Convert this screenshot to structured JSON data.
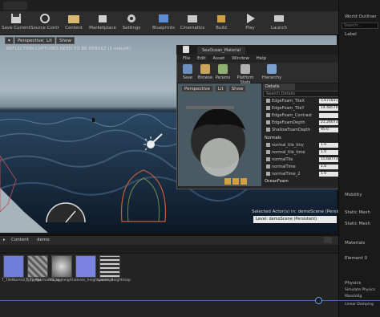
{
  "toolbar": {
    "buttons": [
      {
        "label": "Save Current",
        "icon": "save-icon"
      },
      {
        "label": "Source Control",
        "icon": "source-control-icon"
      },
      {
        "label": "Content",
        "icon": "content-icon"
      },
      {
        "label": "Marketplace",
        "icon": "marketplace-icon"
      },
      {
        "label": "Settings",
        "icon": "settings-icon"
      },
      {
        "label": "Blueprints",
        "icon": "blueprints-icon"
      },
      {
        "label": "Cinematics",
        "icon": "cinematics-icon"
      },
      {
        "label": "Build",
        "icon": "build-icon"
      },
      {
        "label": "Play",
        "icon": "play-icon"
      },
      {
        "label": "Launch",
        "icon": "launch-icon"
      }
    ]
  },
  "sidebar": {
    "world_outliner": "World Outliner",
    "search": "Search...",
    "label": "Label",
    "mobility": "Mobility",
    "static_mesh_section": "Static Mesh",
    "static_mesh": "Static Mesh",
    "materials": "Materials",
    "element0": "Element 0",
    "physics": "Physics",
    "simulate": "Simulate Physics",
    "mass": "MassInKg",
    "linear_damping": "Linear Damping"
  },
  "viewport": {
    "perspective": "Perspective",
    "lit": "Lit",
    "show": "Show",
    "warning": "REFLECTION CAPTURES NEED TO BE REBUILT (1 unbuilt)",
    "selected_actors": "Selected Actor(s) in: demoScene (Persistent)",
    "level": "Level: demoScene (Persistent)"
  },
  "material_window": {
    "tab": "SeaOcean_Material",
    "menus": [
      "File",
      "Edit",
      "Asset",
      "Window",
      "Help"
    ],
    "tools": [
      "Save",
      "Browse",
      "Params",
      "Platform Stats",
      "Hierarchy"
    ],
    "preview": {
      "perspective": "Perspective",
      "lit": "Lit",
      "show": "Show"
    },
    "details_tab": "Details",
    "search": "Search Details",
    "params": [
      {
        "name": "EdgeFoam_TileX",
        "value": "5.671831"
      },
      {
        "name": "EdgeFoam_TileY",
        "value": "14.485769"
      },
      {
        "name": "EdgeFoam_Contrast",
        "value": ""
      },
      {
        "name": "EdgeFoamDepth",
        "value": "21.260735"
      },
      {
        "name": "ShallowFoamDepth",
        "value": "95.0"
      }
    ],
    "normals_group": "Normals",
    "normal_params": [
      {
        "name": "normal_tile_tiny",
        "value": "1.0"
      },
      {
        "name": "normal_tile_time",
        "value": "1.0"
      },
      {
        "name": "normalTile",
        "value": "15.687735"
      },
      {
        "name": "normalTime",
        "value": "1.0"
      },
      {
        "name": "normalTime_2",
        "value": "1.0"
      }
    ],
    "ocean_group": "OceanFoam"
  },
  "content_browser": {
    "tab": "Content",
    "path": "demo",
    "assets": [
      {
        "label": "T_TileNormal_tiny_tga",
        "color": "#6f7ed8"
      },
      {
        "label": "T_TileNormalNS_tga",
        "color": "#9a9a9a"
      },
      {
        "label": "noise_height",
        "color": "#bdbdbd"
      },
      {
        "label": "waves_height_normal",
        "color": "#7a84e0"
      },
      {
        "label": "waves_heightmap",
        "color": "#6c6c6c"
      }
    ]
  },
  "colors": {
    "accent": "#3b6fb3",
    "bg": "#141414"
  }
}
